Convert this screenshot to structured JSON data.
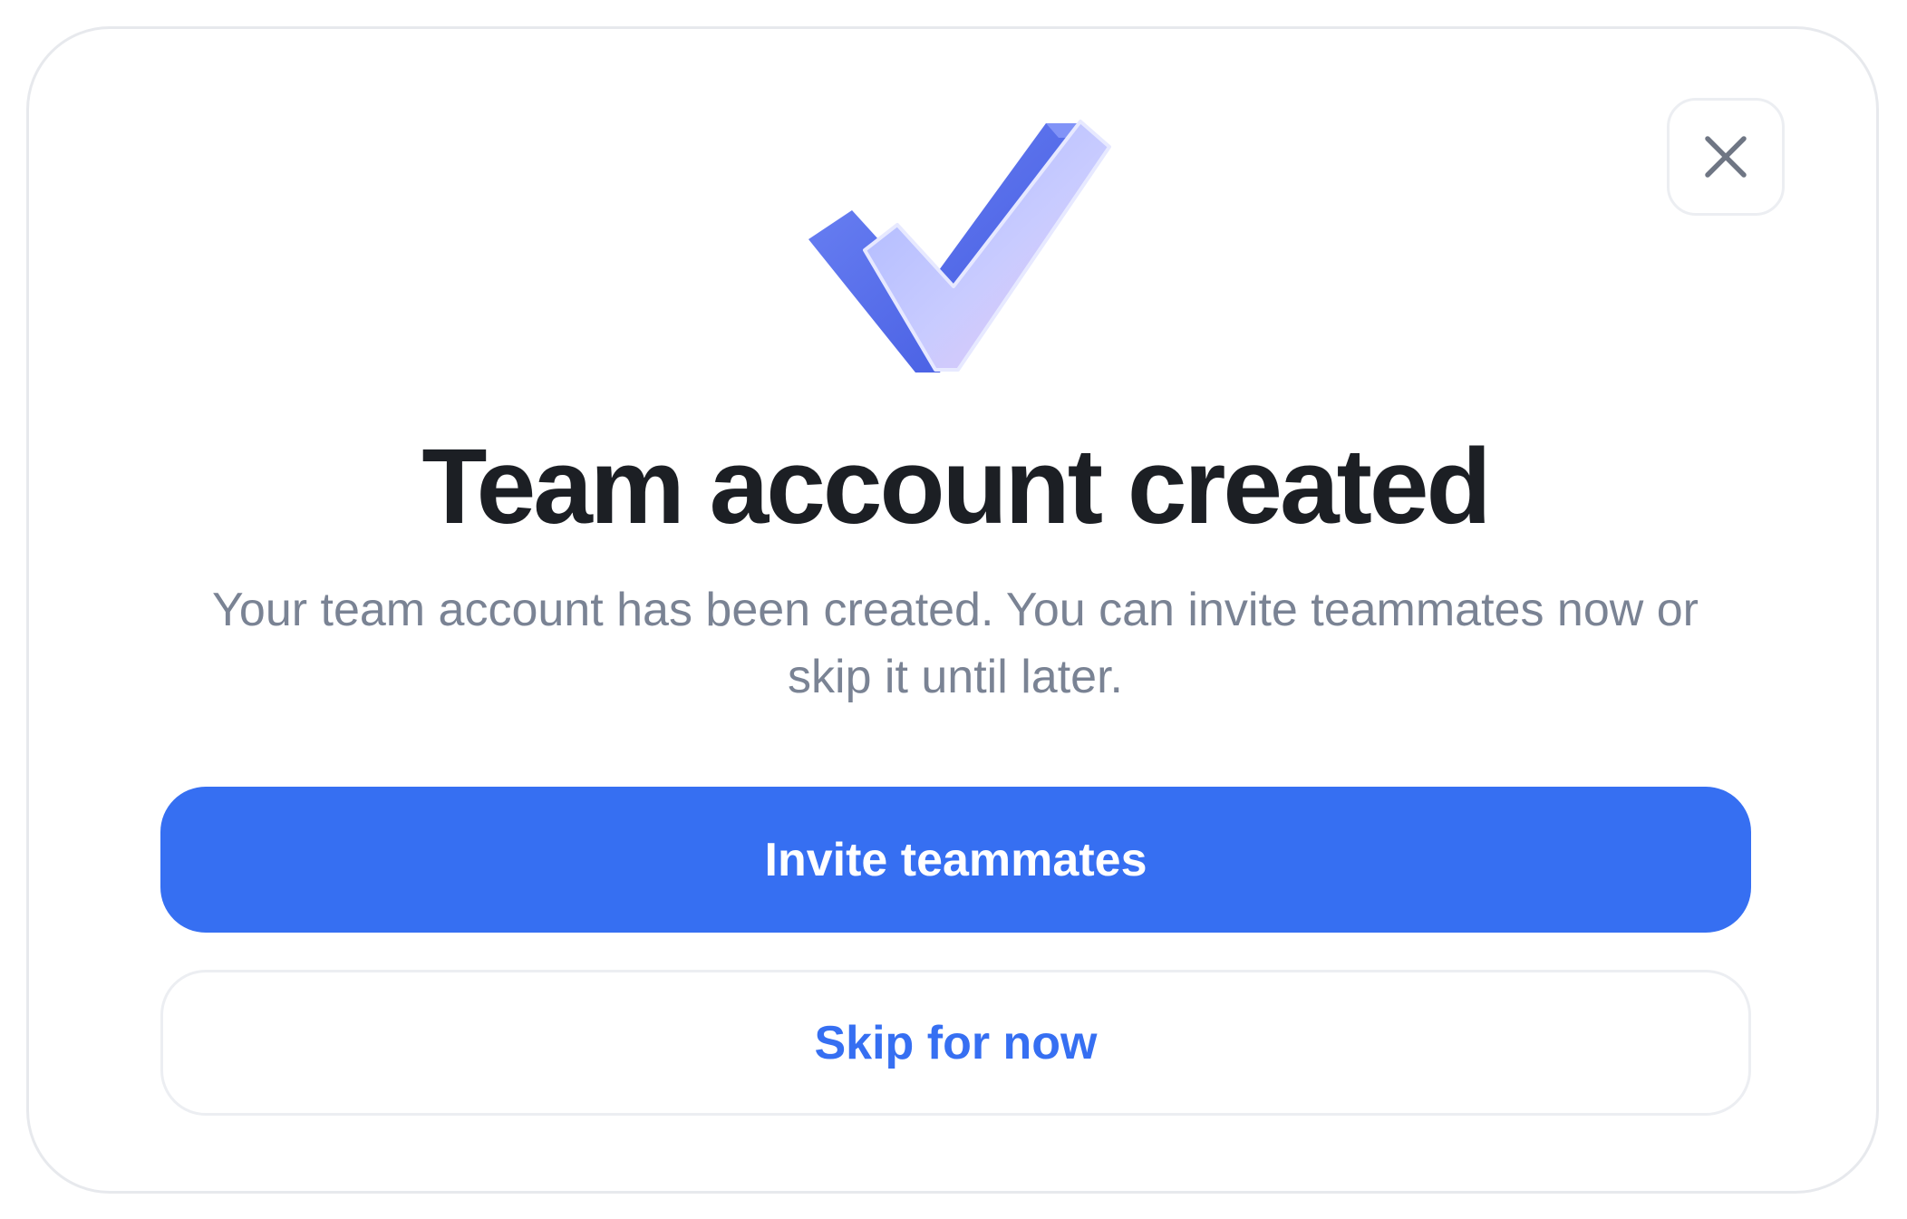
{
  "dialog": {
    "title": "Team account created",
    "description": "Your team account has been created. You can invite teammates now or skip it until later.",
    "icon": "checkmark-icon",
    "close_icon": "close-icon"
  },
  "actions": {
    "primary_label": "Invite teammates",
    "secondary_label": "Skip for now"
  },
  "colors": {
    "primary": "#366ff2",
    "primary_text": "#ffffff",
    "secondary_text": "#366ff2",
    "title": "#1c1f24",
    "description": "#7a8394",
    "border": "#e7e9ed",
    "check_front": "#c3c6ff",
    "check_back": "#5a70ea"
  }
}
